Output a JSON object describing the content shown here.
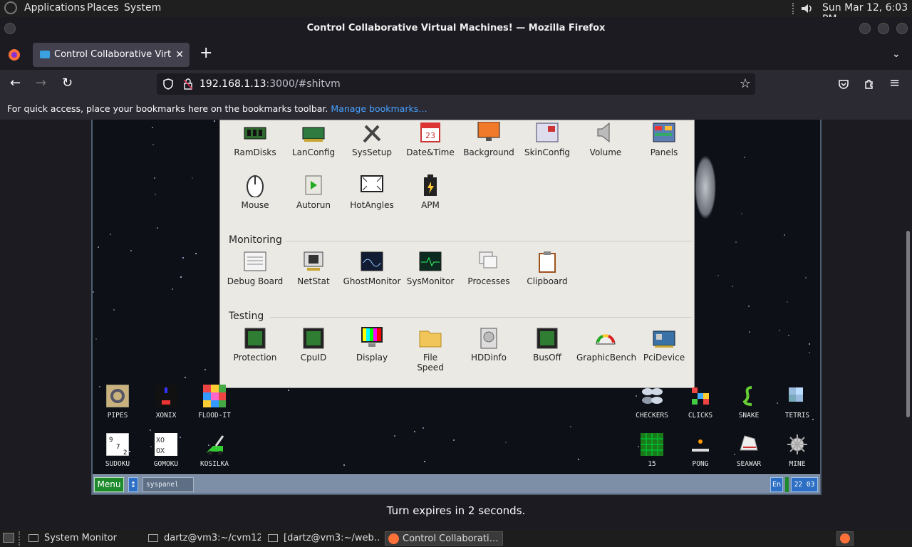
{
  "gnome_top": {
    "apps": "Applications",
    "places": "Places",
    "system": "System",
    "clock": "Sun Mar 12,  6:03 PM"
  },
  "window": {
    "title": "Control Collaborative Virtual Machines! — Mozilla Firefox"
  },
  "tab": {
    "label": "Control Collaborative Virtual Machines!"
  },
  "url": {
    "host": "192.168.1.13",
    "path": ":3000/#shitvm"
  },
  "bookmarks": {
    "hint": "For quick access, place your bookmarks here on the bookmarks toolbar.",
    "manage": "Manage bookmarks…"
  },
  "syspanel": {
    "row_top": [
      "RamDisks",
      "LanConfig",
      "SysSetup",
      "Date&Time",
      "Background",
      "SkinConfig",
      "Volume",
      "Panels"
    ],
    "row_second": [
      "Mouse",
      "Autorun",
      "HotAngles",
      "APM"
    ],
    "monitoring_title": "Monitoring",
    "monitoring": [
      "Debug Board",
      "NetStat",
      "GhostMonitor",
      "SysMonitor",
      "Processes",
      "Clipboard"
    ],
    "testing_title": "Testing",
    "testing": [
      "Protection",
      "CpuID",
      "Display",
      "File Speed",
      "HDDinfo",
      "BusOff",
      "GraphicBench",
      "PciDevice"
    ]
  },
  "desktop_left": [
    [
      "PIPES",
      "XONIX",
      "FLOOD-IT"
    ],
    [
      "SUDOKU",
      "GOMOKU",
      "KOSILKA"
    ]
  ],
  "desktop_right": [
    [
      "CHECKERS",
      "CLICKS",
      "SNAKE",
      "TETRIS"
    ],
    [
      "15",
      "PONG",
      "SEAWAR",
      "MINE"
    ]
  ],
  "vm_taskbar": {
    "menu": "Menu",
    "task": "syspanel",
    "lang": "En",
    "clock": "22 03"
  },
  "status": "Turn expires in 2 seconds.",
  "os_taskbar": [
    "System Monitor",
    "dartz@vm3:~/cvm12",
    "[dartz@vm3:~/web…",
    "Control Collaborati…"
  ],
  "colors": {
    "accent_link": "#45a1ff",
    "vm_bg": "#0d1017",
    "panel_bg": "#ebe9e4",
    "menu_green": "#1d8a2c"
  }
}
